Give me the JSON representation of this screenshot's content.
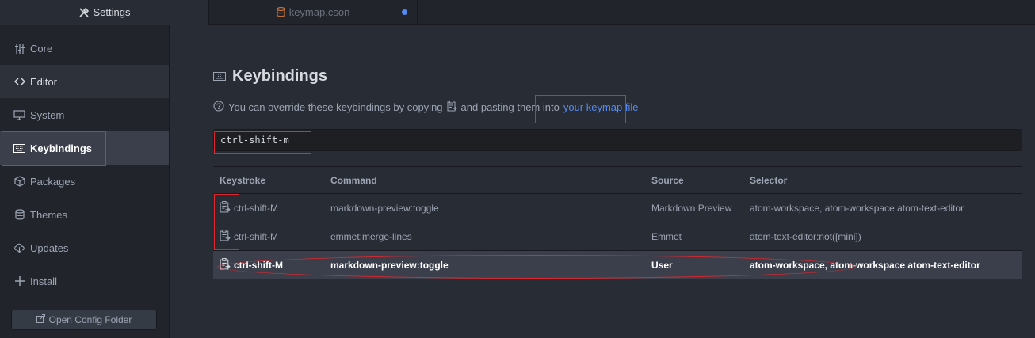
{
  "tabs": [
    {
      "label": "Settings",
      "icon": "tools-icon",
      "active": true
    },
    {
      "label": "keymap.cson",
      "icon": "database-icon",
      "active": false,
      "modified": true
    }
  ],
  "sidebar": {
    "items": [
      {
        "label": "Core",
        "icon": "settings-sliders-icon"
      },
      {
        "label": "Editor",
        "icon": "code-icon"
      },
      {
        "label": "System",
        "icon": "device-desktop-icon"
      },
      {
        "label": "Keybindings",
        "icon": "keyboard-icon"
      },
      {
        "label": "Packages",
        "icon": "package-icon"
      },
      {
        "label": "Themes",
        "icon": "paintcan-icon"
      },
      {
        "label": "Updates",
        "icon": "cloud-download-icon"
      },
      {
        "label": "Install",
        "icon": "plus-icon"
      }
    ],
    "open_config_label": "Open Config Folder"
  },
  "main": {
    "title": "Keybindings",
    "help_prefix": "You can override these keybindings by copying",
    "help_middle": "and pasting them into",
    "help_link": "your keymap file",
    "search_value": "ctrl-shift-m",
    "columns": [
      "Keystroke",
      "Command",
      "Source",
      "Selector"
    ],
    "rows": [
      {
        "keystroke": "ctrl-shift-M",
        "command": "markdown-preview:toggle",
        "source": "Markdown Preview",
        "selector": "atom-workspace, atom-workspace atom-text-editor"
      },
      {
        "keystroke": "ctrl-shift-M",
        "command": "emmet:merge-lines",
        "source": "Emmet",
        "selector": "atom-text-editor:not([mini])"
      },
      {
        "keystroke": "ctrl-shift-M",
        "command": "markdown-preview:toggle",
        "source": "User",
        "selector": "atom-workspace, atom-workspace atom-text-editor"
      }
    ]
  },
  "colors": {
    "accent": "#568af2",
    "annotation": "#e0282e"
  }
}
